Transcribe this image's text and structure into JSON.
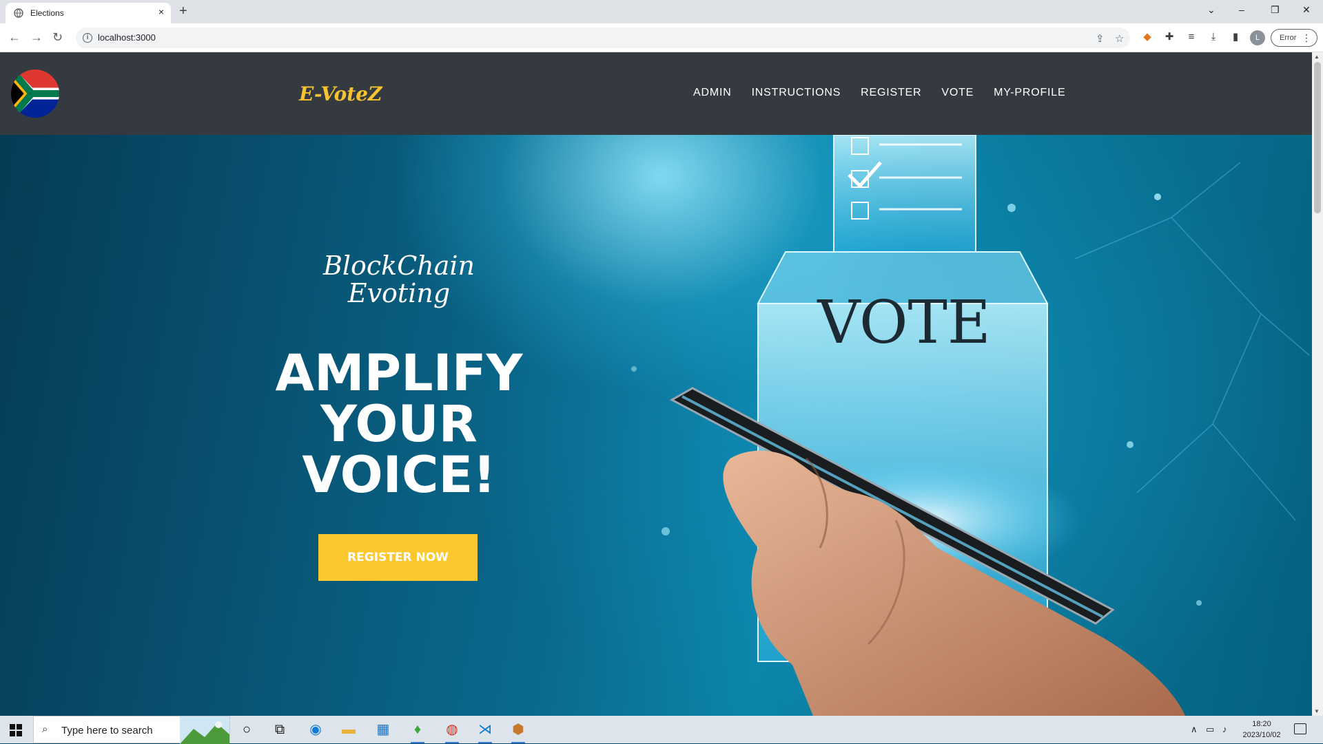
{
  "browser": {
    "tab_title": "Elections",
    "tab_close": "×",
    "new_tab": "+",
    "url": "localhost:3000",
    "profile_initial": "L",
    "error_label": "Error",
    "window_controls": [
      "⌄",
      "–",
      "❐",
      "✕"
    ]
  },
  "site": {
    "brand": "E-VoteZ",
    "nav": [
      "ADMIN",
      "INSTRUCTIONS",
      "REGISTER",
      "VOTE",
      "MY-PROFILE"
    ]
  },
  "hero": {
    "subtitle_line1": "BlockChain",
    "subtitle_line2": "Evoting",
    "headline_line1": "AMPLIFY",
    "headline_line2": "YOUR",
    "headline_line3": "VOICE!",
    "cta_label": "REGISTER NOW",
    "ballot_box_text": "VOTE",
    "colors": {
      "cta": "#fcc830",
      "brand": "#f7c32e",
      "header": "#343a40"
    }
  },
  "taskbar": {
    "search_placeholder": "Type here to search",
    "time": "18:20",
    "date": "2023/10/02"
  }
}
